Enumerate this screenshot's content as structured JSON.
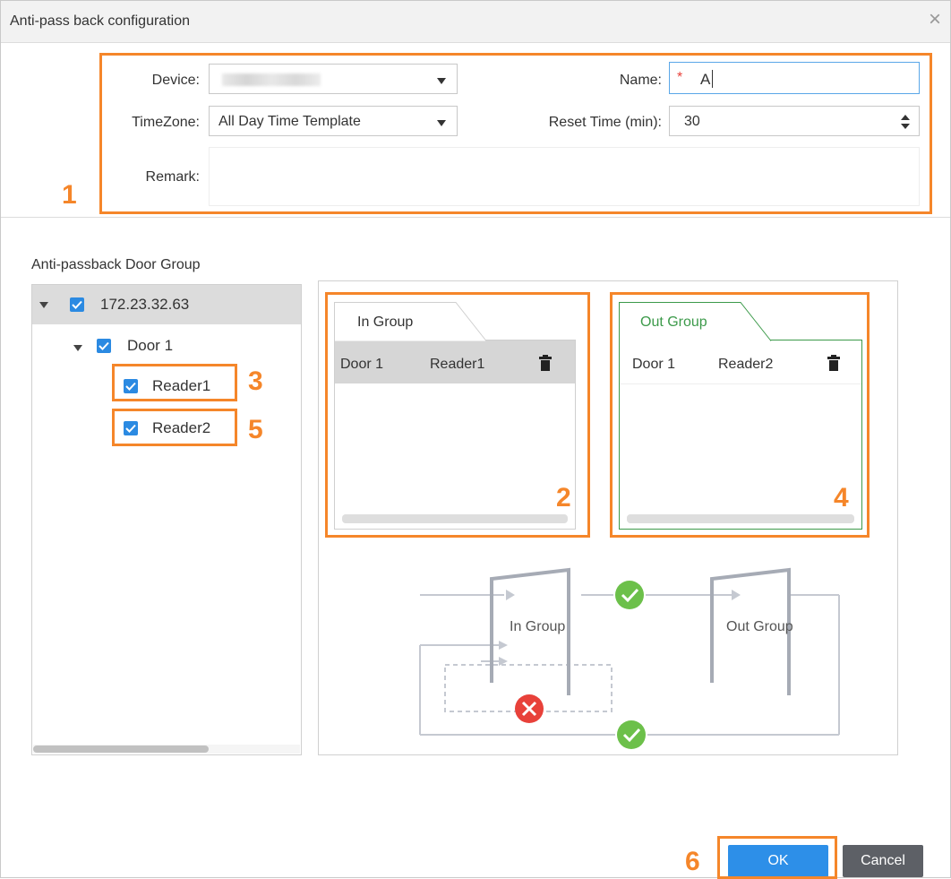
{
  "window": {
    "title": "Anti-pass back configuration",
    "close_symbol": "×"
  },
  "form": {
    "device_label": "Device:",
    "timezone_label": "TimeZone:",
    "timezone_value": "All Day Time Template",
    "remark_label": "Remark:",
    "remark_value": "",
    "name_label": "Name:",
    "name_required": "*",
    "name_value": "A",
    "reset_label": "Reset Time (min):",
    "reset_value": "30"
  },
  "tree": {
    "section_title": "Anti-passback Door Group",
    "root": "172.23.32.63",
    "door": "Door 1",
    "readers": [
      "Reader1",
      "Reader2"
    ]
  },
  "groups": {
    "in_tab": "In Group",
    "out_tab": "Out Group",
    "in_rows": [
      {
        "door": "Door 1",
        "reader": "Reader1"
      }
    ],
    "out_rows": [
      {
        "door": "Door 1",
        "reader": "Reader2"
      }
    ]
  },
  "diagram": {
    "in_label": "In Group",
    "out_label": "Out Group"
  },
  "annotations": [
    "1",
    "2",
    "3",
    "4",
    "5",
    "6"
  ],
  "buttons": {
    "ok": "OK",
    "cancel": "Cancel"
  },
  "colors": {
    "accent_orange": "#f5862a",
    "checkbox_blue": "#2b8ae2",
    "ok_blue": "#2d8fe8",
    "out_group_green": "#3c9a4a",
    "check_green": "#6cc04a",
    "error_red": "#e8413a"
  }
}
